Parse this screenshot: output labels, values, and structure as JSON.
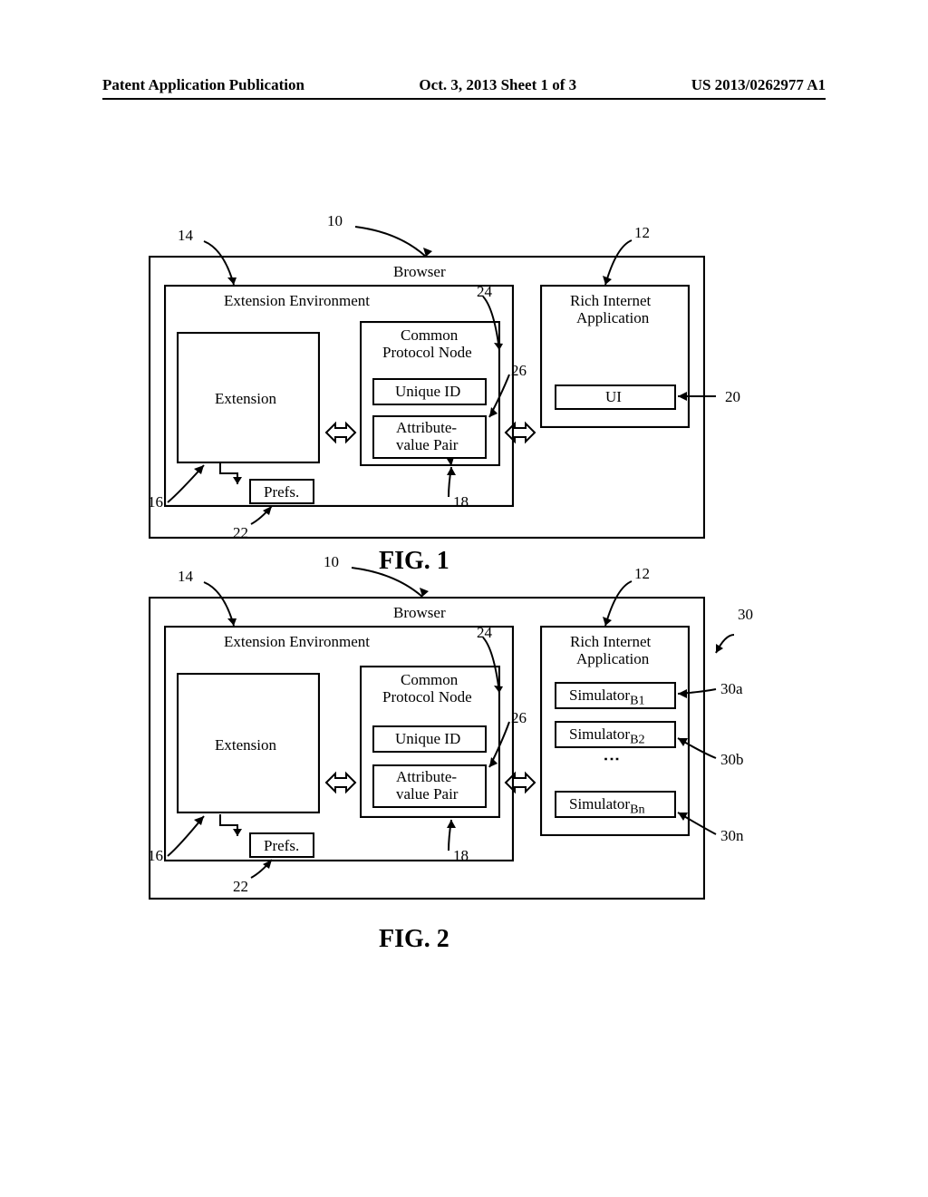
{
  "header": {
    "left": "Patent Application Publication",
    "center": "Oct. 3, 2013  Sheet 1 of 3",
    "right": "US 2013/0262977 A1"
  },
  "fig1": {
    "caption": "FIG. 1",
    "browser": "Browser",
    "extEnv": "Extension Environment",
    "extension": "Extension",
    "protoNode": {
      "l1": "Common",
      "l2": "Protocol Node"
    },
    "uniqueId": "Unique ID",
    "attrPair": {
      "l1": "Attribute-",
      "l2": "value Pair"
    },
    "prefs": "Prefs.",
    "ria": {
      "l1": "Rich Internet",
      "l2": "Application"
    },
    "ui": "UI",
    "refs": {
      "r10": "10",
      "r12": "12",
      "r14": "14",
      "r16": "16",
      "r18": "18",
      "r20": "20",
      "r22": "22",
      "r24": "24",
      "r26": "26"
    }
  },
  "fig2": {
    "caption": "FIG. 2",
    "browser": "Browser",
    "extEnv": "Extension Environment",
    "extension": "Extension",
    "protoNode": {
      "l1": "Common",
      "l2": "Protocol Node"
    },
    "uniqueId": "Unique ID",
    "attrPair": {
      "l1": "Attribute-",
      "l2": "value Pair"
    },
    "prefs": "Prefs.",
    "ria": {
      "l1": "Rich Internet",
      "l2": "Application"
    },
    "sim": {
      "b1a": "Simulator",
      "b1s": "B1",
      "b2a": "Simulator",
      "b2s": "B2",
      "bna": "Simulator",
      "bns": "Bn"
    },
    "refs": {
      "r10": "10",
      "r12": "12",
      "r14": "14",
      "r16": "16",
      "r18": "18",
      "r22": "22",
      "r24": "24",
      "r26": "26",
      "r30": "30",
      "r30a": "30a",
      "r30b": "30b",
      "r30n": "30n"
    }
  }
}
